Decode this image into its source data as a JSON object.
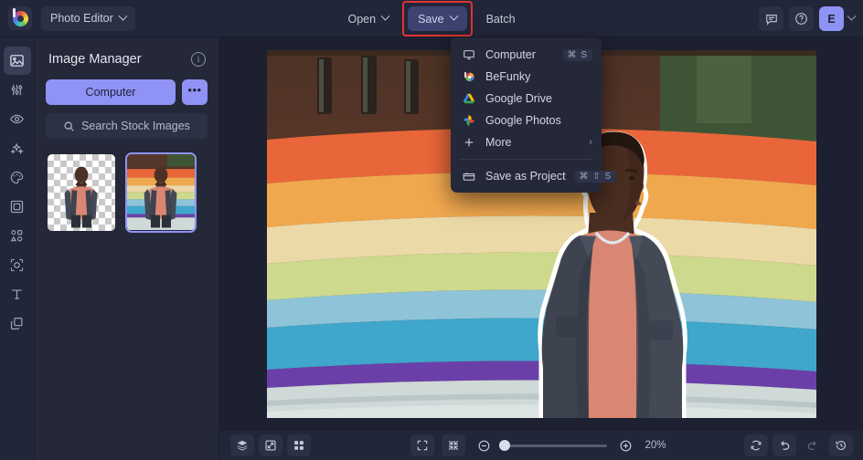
{
  "app": {
    "logo": "befunky-logo-icon",
    "mode_label": "Photo Editor"
  },
  "toolbar": {
    "open_label": "Open",
    "save_label": "Save",
    "batch_label": "Batch",
    "feedback_icon": "chat-icon",
    "help_icon": "help-icon",
    "avatar_initial": "E",
    "save_highlight_color": "#e03434",
    "accent_color": "#8f93f5"
  },
  "save_menu": {
    "items": [
      {
        "label": "Computer",
        "icon": "monitor-icon",
        "shortcut": "⌘ S"
      },
      {
        "label": "BeFunky",
        "icon": "befunky-icon",
        "shortcut": ""
      },
      {
        "label": "Google Drive",
        "icon": "google-drive-icon",
        "shortcut": ""
      },
      {
        "label": "Google Photos",
        "icon": "google-photos-icon",
        "shortcut": ""
      },
      {
        "label": "More",
        "icon": "plus-icon",
        "shortcut": "",
        "submenu": true
      }
    ],
    "footer": {
      "label": "Save as Project",
      "icon": "folder-icon",
      "shortcut": "⌘ ⇧ S"
    }
  },
  "rail": {
    "items": [
      {
        "name": "image-manager",
        "icon": "image-icon",
        "active": true
      },
      {
        "name": "edit",
        "icon": "sliders-icon",
        "active": false
      },
      {
        "name": "touch-up",
        "icon": "eye-icon",
        "active": false
      },
      {
        "name": "effects",
        "icon": "sparkles-icon",
        "active": false
      },
      {
        "name": "artsy",
        "icon": "palette-icon",
        "active": false
      },
      {
        "name": "frames",
        "icon": "frame-icon",
        "active": false
      },
      {
        "name": "graphics",
        "icon": "shapes-icon",
        "active": false
      },
      {
        "name": "overlays",
        "icon": "cutout-icon",
        "active": false
      },
      {
        "name": "text",
        "icon": "text-icon",
        "active": false
      },
      {
        "name": "layers",
        "icon": "layers-icon",
        "active": false
      }
    ]
  },
  "panel": {
    "title": "Image Manager",
    "info_icon": "info-icon",
    "computer_label": "Computer",
    "more_label": "•••",
    "search_label": "Search Stock Images",
    "search_icon": "search-icon",
    "thumbnails": [
      {
        "name": "cutout-thumbnail",
        "selected": false,
        "background": "transparent-checkerboard"
      },
      {
        "name": "rainbow-thumbnail",
        "selected": true,
        "background": "rainbow-mural"
      }
    ]
  },
  "canvas": {
    "image_alt": "Man in denim jacket in front of rainbow mural",
    "rainbow_bands": [
      "#e8663a",
      "#f0a84e",
      "#ecd9a8",
      "#cdd98d",
      "#8fc4d8",
      "#3fa6cc",
      "#6b3fa8"
    ]
  },
  "bottombar": {
    "left_tools": [
      {
        "name": "layers-button",
        "icon": "layers-stack-icon"
      },
      {
        "name": "transform-button",
        "icon": "transform-icon"
      },
      {
        "name": "grid-button",
        "icon": "grid-icon"
      }
    ],
    "center_tools": [
      {
        "name": "fit-screen-button",
        "icon": "expand-icon"
      },
      {
        "name": "actual-size-button",
        "icon": "collapse-icon"
      }
    ],
    "zoom_out_icon": "minus-circle-icon",
    "zoom_in_icon": "plus-circle-icon",
    "zoom_level": "20%",
    "right_tools": [
      {
        "name": "reset-button",
        "icon": "refresh-icon",
        "disabled": false
      },
      {
        "name": "undo-button",
        "icon": "undo-icon",
        "disabled": false
      },
      {
        "name": "redo-button",
        "icon": "redo-icon",
        "disabled": true
      },
      {
        "name": "history-button",
        "icon": "history-icon",
        "disabled": false
      }
    ]
  }
}
